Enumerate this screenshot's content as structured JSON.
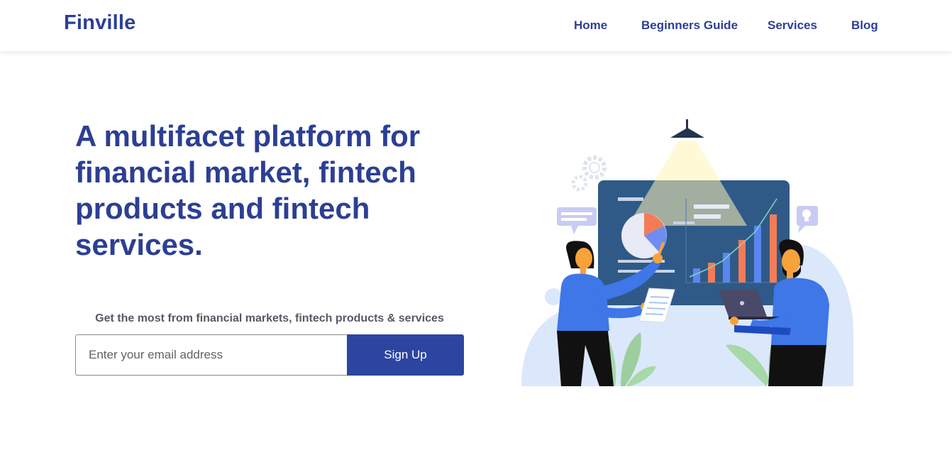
{
  "brand": {
    "name": "Finville"
  },
  "nav": {
    "items": [
      {
        "label": "Home"
      },
      {
        "label": "Beginners Guide"
      },
      {
        "label": "Services"
      },
      {
        "label": "Blog"
      }
    ]
  },
  "hero": {
    "title": "A multifacet platform for financial market, fintech products and fintech services.",
    "subtitle": "Get the most from financial markets, fintech products & services"
  },
  "signup": {
    "email_placeholder": "Enter your email address",
    "email_value": "",
    "button_label": "Sign Up"
  },
  "colors": {
    "brand": "#2c3f94",
    "button": "#2c45a0",
    "board": "#2f5a87",
    "accent_orange": "#f47b57",
    "accent_blue": "#5b86ef"
  },
  "illustration": {
    "icons": [
      "ceiling-lamp-icon",
      "gear-icon",
      "pie-chart-icon",
      "bar-chart-icon",
      "lightbulb-icon",
      "laptop-icon",
      "document-icon",
      "speech-bubble-icon"
    ],
    "bar_values": [
      1,
      1.4,
      2.2,
      3.3,
      4.2,
      5
    ]
  }
}
